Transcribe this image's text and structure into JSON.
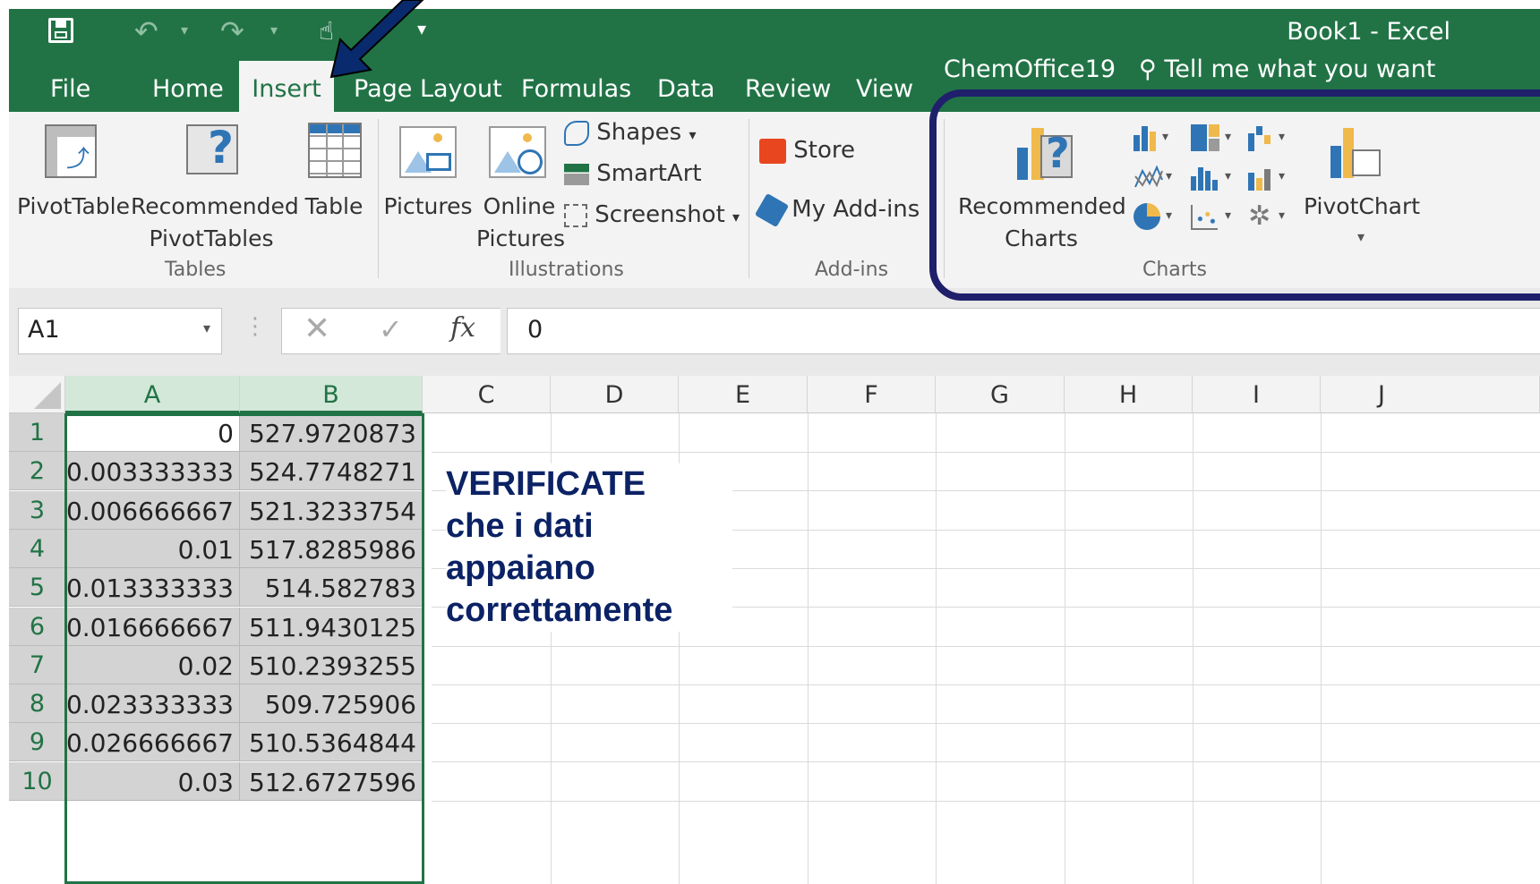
{
  "window": {
    "title": "Book1 - Excel"
  },
  "ribbon_tabs": [
    "File",
    "Home",
    "Insert",
    "Page Layout",
    "Formulas",
    "Data",
    "Review",
    "View",
    "ChemOffice19"
  ],
  "active_tab": "Insert",
  "tell_me": "Tell me what you want",
  "groups": {
    "tables": {
      "label": "Tables",
      "pivottable": "PivotTable",
      "recommended_pivot_1": "Recommended",
      "recommended_pivot_2": "PivotTables",
      "table": "Table"
    },
    "illustrations": {
      "label": "Illustrations",
      "pictures": "Pictures",
      "online_1": "Online",
      "online_2": "Pictures",
      "shapes": "Shapes",
      "smartart": "SmartArt",
      "screenshot": "Screenshot"
    },
    "addins": {
      "label": "Add-ins",
      "store": "Store",
      "my_addins": "My Add-ins"
    },
    "charts": {
      "label": "Charts",
      "recommended_1": "Recommended",
      "recommended_2": "Charts",
      "pivotchart": "PivotChart"
    }
  },
  "formula_bar": {
    "name_box": "A1",
    "fx": "fx",
    "content": "0"
  },
  "columns": [
    "A",
    "B",
    "C",
    "D",
    "E",
    "F",
    "G",
    "H",
    "I",
    "J"
  ],
  "rows": [
    {
      "n": "1",
      "a": "0",
      "b": "527.9720873"
    },
    {
      "n": "2",
      "a": "0.003333333",
      "b": "524.7748271"
    },
    {
      "n": "3",
      "a": "0.006666667",
      "b": "521.3233754"
    },
    {
      "n": "4",
      "a": "0.01",
      "b": "517.8285986"
    },
    {
      "n": "5",
      "a": "0.013333333",
      "b": "514.582783"
    },
    {
      "n": "6",
      "a": "0.016666667",
      "b": "511.9430125"
    },
    {
      "n": "7",
      "a": "0.02",
      "b": "510.2393255"
    },
    {
      "n": "8",
      "a": "0.023333333",
      "b": "509.725906"
    },
    {
      "n": "9",
      "a": "0.026666667",
      "b": "510.5364844"
    },
    {
      "n": "10",
      "a": "0.03",
      "b": "512.6727596"
    }
  ],
  "annotation": {
    "line1": "VERIFICATE",
    "line2": "che i dati",
    "line3": "appaiano",
    "line4": "correttamente",
    "color": "#0b2265"
  },
  "colors": {
    "excel_green": "#217346",
    "highlight_box": "#1f1f6b",
    "arrow": "#0a2a6e"
  }
}
